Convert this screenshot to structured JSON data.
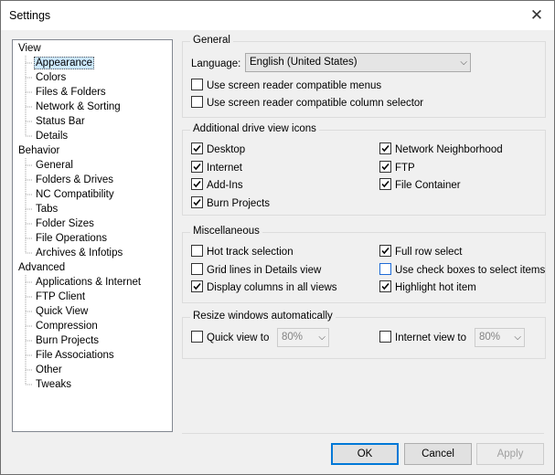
{
  "window": {
    "title": "Settings"
  },
  "tree": {
    "view": {
      "label": "View",
      "children": [
        "Appearance",
        "Colors",
        "Files & Folders",
        "Network & Sorting",
        "Status Bar",
        "Details"
      ]
    },
    "behavior": {
      "label": "Behavior",
      "children": [
        "General",
        "Folders & Drives",
        "NC Compatibility",
        "Tabs",
        "Folder Sizes",
        "File Operations",
        "Archives & Infotips"
      ]
    },
    "advanced": {
      "label": "Advanced",
      "children": [
        "Applications & Internet",
        "FTP Client",
        "Quick View",
        "Compression",
        "Burn Projects",
        "File Associations",
        "Other",
        "Tweaks"
      ]
    },
    "selected": "Appearance"
  },
  "general": {
    "title": "General",
    "language_label": "Language:",
    "language_value": "English (United States)",
    "screen_reader_menus": {
      "label": "Use screen reader compatible menus",
      "checked": false
    },
    "screen_reader_columns": {
      "label": "Use screen reader compatible column selector",
      "checked": false
    }
  },
  "drive_icons": {
    "title": "Additional drive view icons",
    "items": [
      {
        "label": "Desktop",
        "checked": true
      },
      {
        "label": "Internet",
        "checked": true
      },
      {
        "label": "Add-Ins",
        "checked": true
      },
      {
        "label": "Burn Projects",
        "checked": true
      },
      {
        "label": "Network Neighborhood",
        "checked": true
      },
      {
        "label": "FTP",
        "checked": true
      },
      {
        "label": "File Container",
        "checked": true
      }
    ]
  },
  "misc": {
    "title": "Miscellaneous",
    "items": [
      {
        "label": "Hot track selection",
        "checked": false
      },
      {
        "label": "Grid lines in Details view",
        "checked": false
      },
      {
        "label": "Display columns in all views",
        "checked": true
      },
      {
        "label": "Full row select",
        "checked": true
      },
      {
        "label": "Use check boxes to select items",
        "checked": false
      },
      {
        "label": "Highlight hot item",
        "checked": true
      }
    ]
  },
  "resize": {
    "title": "Resize windows automatically",
    "quick_view": {
      "label": "Quick view to",
      "checked": false,
      "value": "80%"
    },
    "internet_view": {
      "label": "Internet view to",
      "checked": false,
      "value": "80%"
    }
  },
  "buttons": {
    "ok": "OK",
    "cancel": "Cancel",
    "apply": "Apply"
  },
  "icons": {
    "close": "close-icon",
    "dropdown": "chevron-down-icon",
    "check": "checkmark-icon"
  }
}
